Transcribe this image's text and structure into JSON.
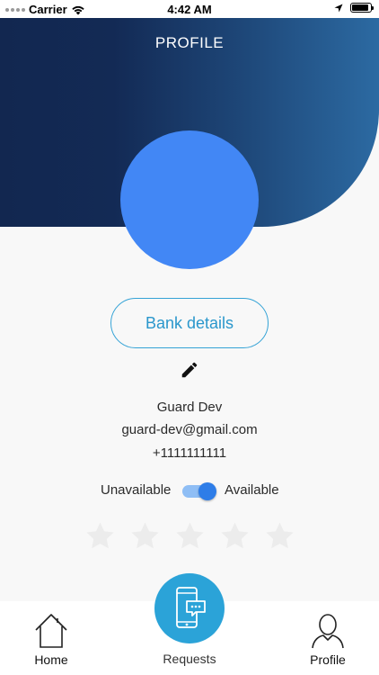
{
  "status_bar": {
    "carrier": "Carrier",
    "time": "4:42 AM",
    "battery_level": 0.9
  },
  "header": {
    "title": "PROFILE",
    "gradient_start": "#122750",
    "gradient_end": "#2c6aa2"
  },
  "avatar": {
    "color": "#4287f5"
  },
  "bank_details": {
    "label": "Bank details",
    "accent": "#2a97cc"
  },
  "user": {
    "name": "Guard Dev",
    "email": "guard-dev@gmail.com",
    "phone": "+1111111111"
  },
  "availability": {
    "off_label": "Unavailable",
    "on_label": "Available",
    "is_available": true
  },
  "rating": {
    "value": 0,
    "max": 5
  },
  "bottom_nav": {
    "home_label": "Home",
    "requests_label": "Requests",
    "profile_label": "Profile"
  },
  "icons": {
    "edit": "pencil-icon",
    "home": "home-icon",
    "requests": "phone-chat-icon",
    "profile": "user-icon",
    "star": "star-icon"
  }
}
